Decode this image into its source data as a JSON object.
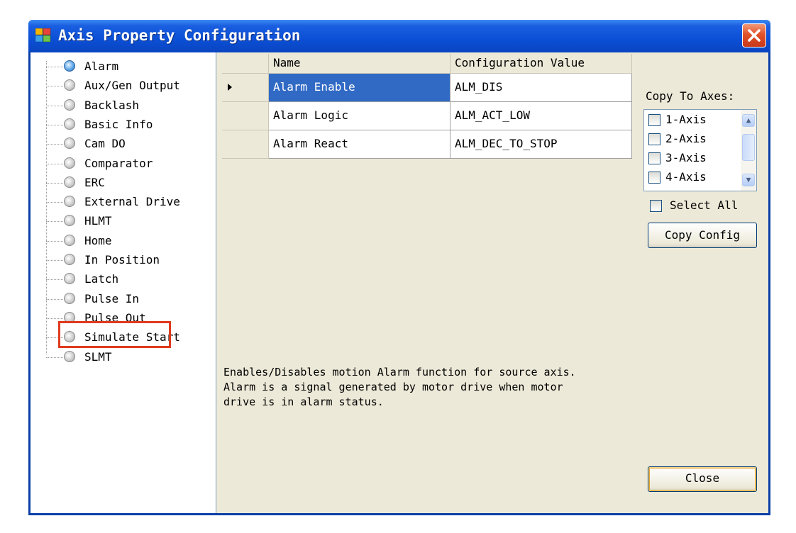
{
  "window": {
    "title": "Axis Property Configuration"
  },
  "tree": {
    "items": [
      {
        "label": "Alarm",
        "selected": true
      },
      {
        "label": "Aux/Gen Output"
      },
      {
        "label": "Backlash"
      },
      {
        "label": "Basic Info"
      },
      {
        "label": "Cam DO"
      },
      {
        "label": "Comparator"
      },
      {
        "label": "ERC"
      },
      {
        "label": "External Drive"
      },
      {
        "label": "HLMT"
      },
      {
        "label": "Home"
      },
      {
        "label": "In Position"
      },
      {
        "label": "Latch"
      },
      {
        "label": "Pulse In"
      },
      {
        "label": "Pulse Out"
      },
      {
        "label": "Simulate Start"
      },
      {
        "label": "SLMT"
      }
    ]
  },
  "grid": {
    "columns": [
      "Name",
      "Configuration Value"
    ],
    "rows": [
      {
        "name": "Alarm Enable",
        "value": "ALM_DIS"
      },
      {
        "name": "Alarm Logic",
        "value": "ALM_ACT_LOW"
      },
      {
        "name": "Alarm React",
        "value": "ALM_DEC_TO_STOP"
      }
    ]
  },
  "description": "Enables/Disables motion Alarm function for source axis.\nAlarm is a signal generated by motor drive when motor\ndrive is in alarm status.",
  "copy_panel": {
    "label": "Copy To Axes:",
    "axes": [
      "1-Axis",
      "2-Axis",
      "3-Axis",
      "4-Axis"
    ],
    "select_all": "Select All",
    "copy_button": "Copy Config"
  },
  "close_button": "Close",
  "colors": {
    "title_bar": "#0b4fd6",
    "selection": "#316ac5",
    "highlight_box": "#e03a1e"
  }
}
